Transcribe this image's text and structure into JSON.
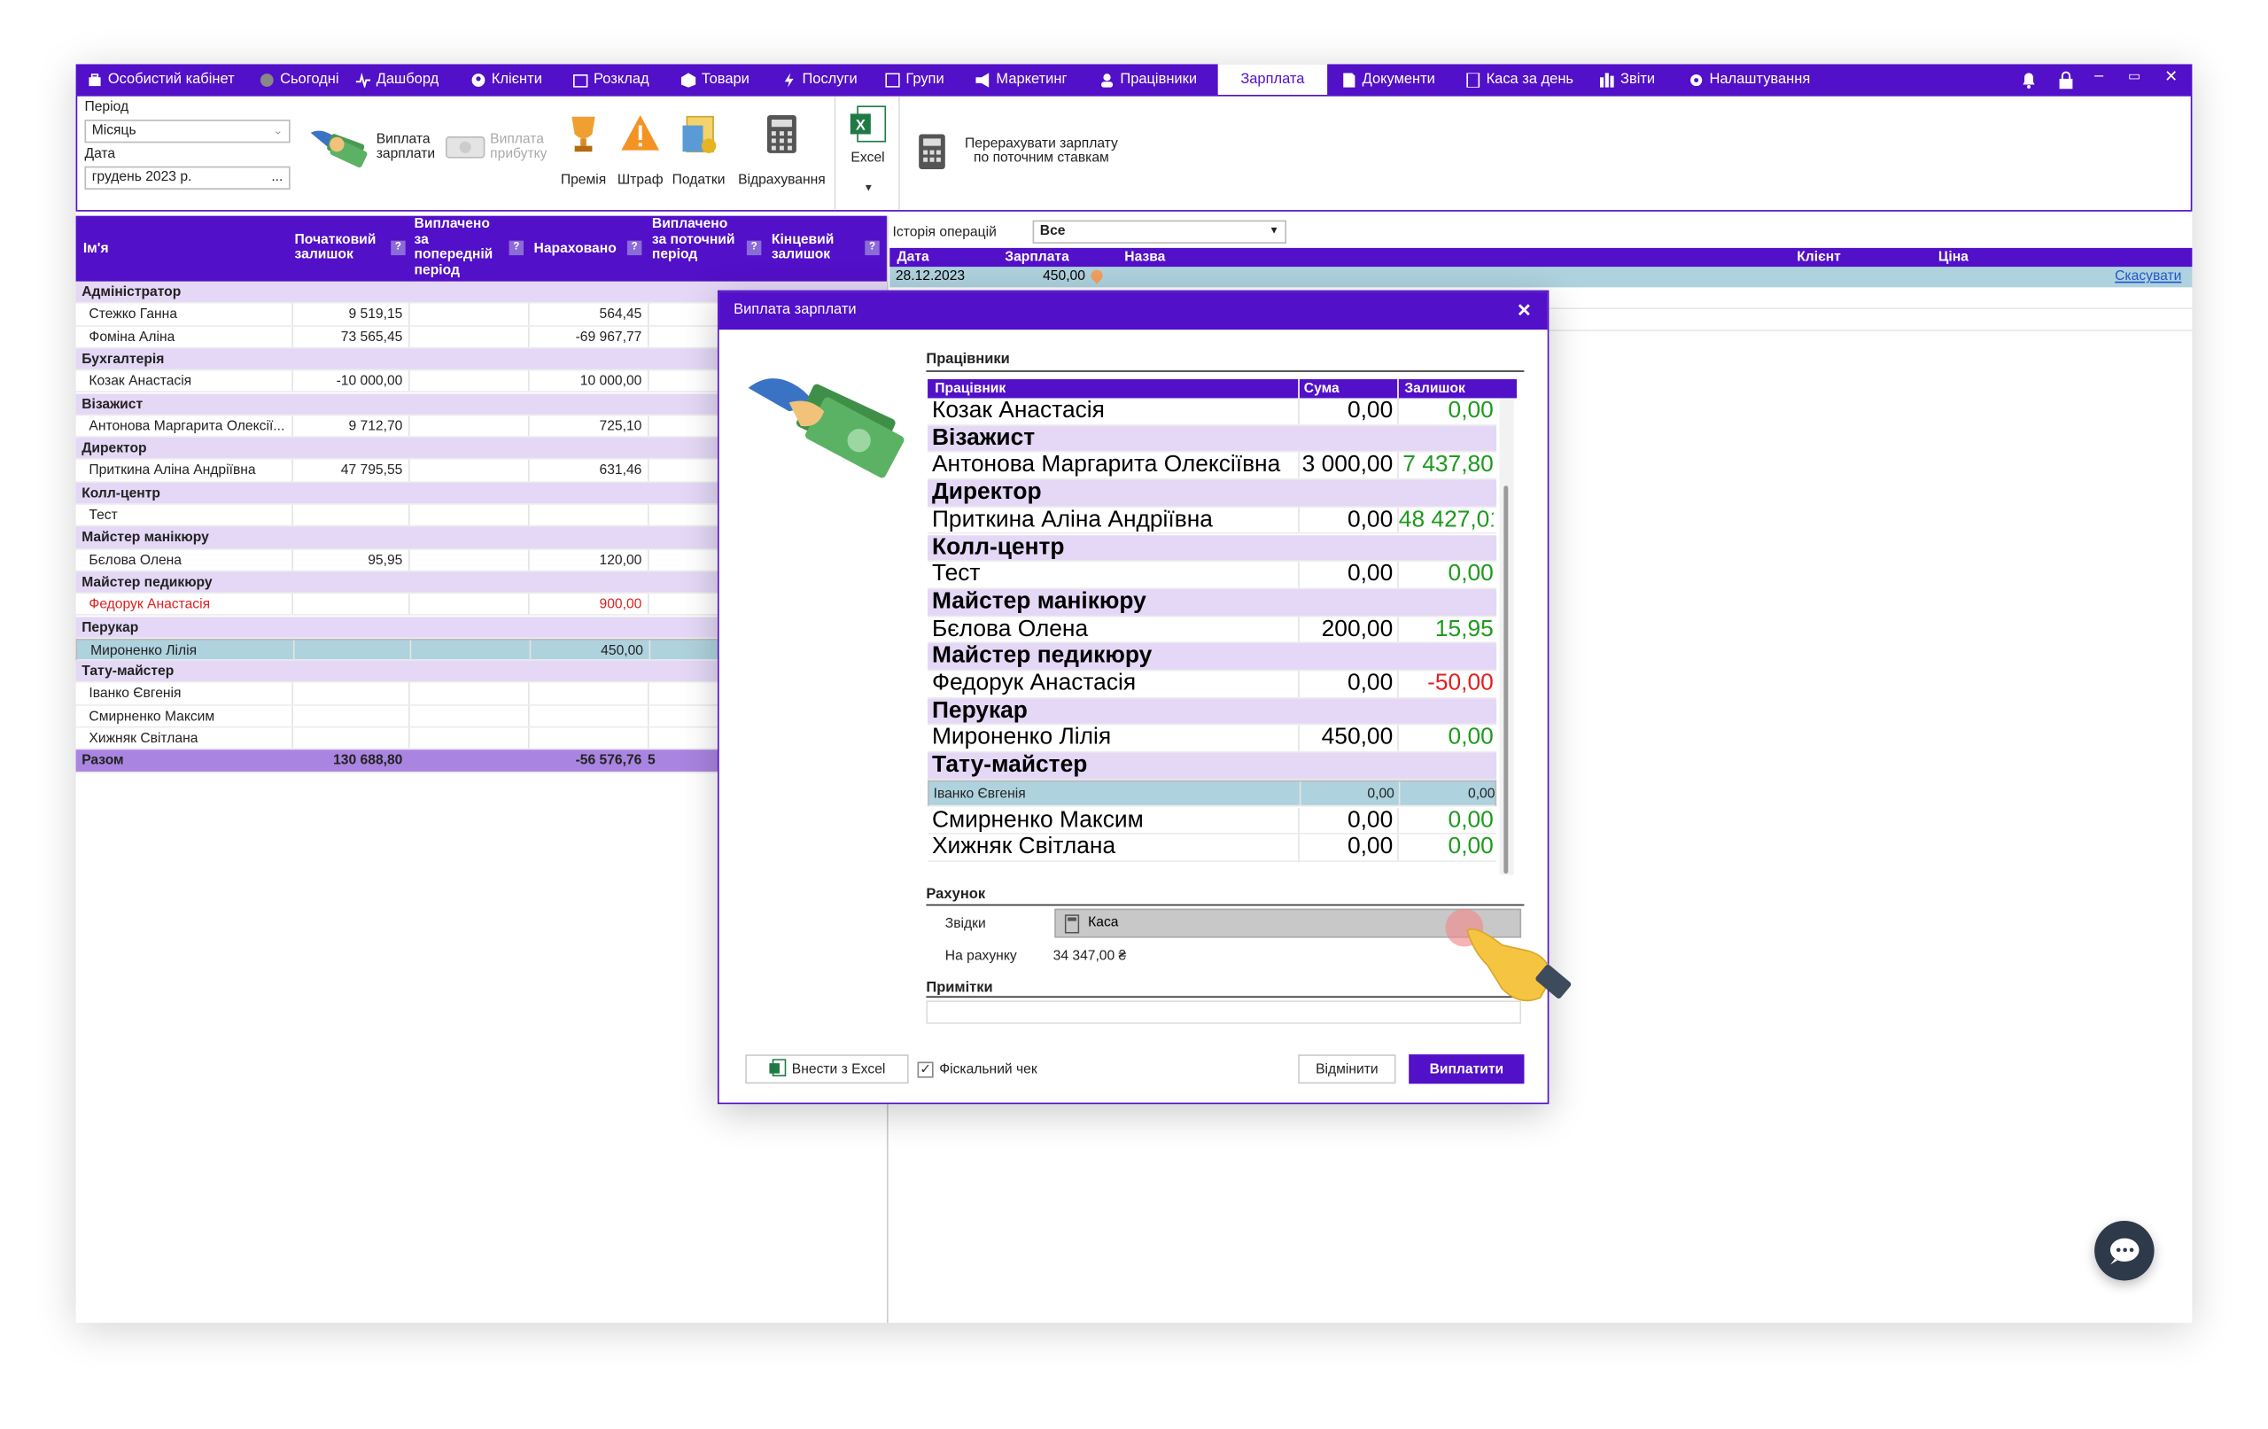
{
  "menu": {
    "items": [
      "Особистий кабінет",
      "Сьогодні",
      "Дашборд",
      "Клієнти",
      "Розклад",
      "Товари",
      "Послуги",
      "Групи",
      "Маркетинг",
      "Працівники",
      "Зарплата",
      "Документи",
      "Каса за день",
      "Звіти",
      "Налаштування"
    ],
    "active": "Зарплата",
    "window_controls": [
      "–",
      "▭",
      "✕"
    ]
  },
  "toolbar": {
    "period_label": "Період",
    "period_value": "Місяць",
    "date_label": "Дата",
    "date_value": "грудень  2023 р.",
    "date_btn": "...",
    "pay_salary": "Виплата зарплати",
    "pay_profit": "Виплата прибутку",
    "bonus": "Премія",
    "fine": "Штраф",
    "taxes": "Податки",
    "deductions": "Відрахування",
    "excel": "Excel",
    "recalc": "Перерахувати зарплату по поточним ставкам"
  },
  "left_table": {
    "headers": [
      "Ім'я",
      "Початковий залишок",
      "Виплачено за попередній період",
      "Нараховано",
      "Виплачено за поточний період",
      "Кінцевий залишок"
    ],
    "help_mark": "?",
    "rows": [
      {
        "type": "group",
        "name": "Адміністратор"
      },
      {
        "type": "row",
        "name": "Стежко Ганна",
        "start": "9 519,15",
        "prev": "",
        "accrued": "564,45"
      },
      {
        "type": "row",
        "name": "Фоміна Аліна",
        "start": "73 565,45",
        "prev": "",
        "accrued": "-69 967,77"
      },
      {
        "type": "group",
        "name": "Бухгалтерія"
      },
      {
        "type": "row",
        "name": "Козак Анастасія",
        "start": "-10 000,00",
        "prev": "",
        "accrued": "10 000,00"
      },
      {
        "type": "group",
        "name": "Візажист"
      },
      {
        "type": "row",
        "name": "Антонова Маргарита Олексії...",
        "start": "9 712,70",
        "prev": "",
        "accrued": "725,10"
      },
      {
        "type": "group",
        "name": "Директор"
      },
      {
        "type": "row",
        "name": "Приткина Аліна Андріївна",
        "start": "47 795,55",
        "prev": "",
        "accrued": "631,46"
      },
      {
        "type": "group",
        "name": "Колл-центр"
      },
      {
        "type": "row",
        "name": "Тест",
        "start": "",
        "prev": "",
        "accrued": ""
      },
      {
        "type": "group",
        "name": "Майстер манікюру"
      },
      {
        "type": "row",
        "name": "Бєлова Олена",
        "start": "95,95",
        "prev": "",
        "accrued": "120,00"
      },
      {
        "type": "group",
        "name": "Майстер педикюру"
      },
      {
        "type": "row-red",
        "name": "Федорук Анастасія",
        "start": "",
        "prev": "",
        "accrued": "900,00"
      },
      {
        "type": "group",
        "name": "Перукар"
      },
      {
        "type": "row-sel",
        "name": "Мироненко Лілія",
        "start": "",
        "prev": "",
        "accrued": "450,00"
      },
      {
        "type": "group",
        "name": "Тату-майстер"
      },
      {
        "type": "row",
        "name": "Іванко Євгенія",
        "start": "",
        "prev": "",
        "accrued": ""
      },
      {
        "type": "row",
        "name": "Смирненко Максим",
        "start": "",
        "prev": "",
        "accrued": ""
      },
      {
        "type": "row",
        "name": "Хижняк Світлана",
        "start": "",
        "prev": "",
        "accrued": ""
      }
    ],
    "total": {
      "name": "Разом",
      "start": "130 688,80",
      "prev": "",
      "accrued": "-56 576,76",
      "paid_cur": "5"
    }
  },
  "history": {
    "label": "Історія операцій",
    "filter": "Все",
    "headers": [
      "Дата",
      "Зарплата",
      "Назва",
      "Клієнт",
      "Ціна"
    ],
    "row": {
      "date": "28.12.2023",
      "salary": "450,00",
      "cancel": "Скасувати"
    }
  },
  "dialog": {
    "title": "Виплата зарплати",
    "close": "✕",
    "employees_section": "Працівники",
    "headers": [
      "Працівник",
      "Сума",
      "Залишок"
    ],
    "rows": [
      {
        "type": "row",
        "name": "Козак Анастасія",
        "sum": "0,00",
        "rest": "0,00",
        "rest_color": "green"
      },
      {
        "type": "group",
        "name": "Візажист"
      },
      {
        "type": "row",
        "name": "Антонова Маргарита Олексіївна",
        "sum": "3 000,00",
        "rest": "7 437,80",
        "rest_color": "green"
      },
      {
        "type": "group",
        "name": "Директор"
      },
      {
        "type": "row",
        "name": "Приткина Аліна Андріївна",
        "sum": "0,00",
        "rest": "48 427,01",
        "rest_color": "green"
      },
      {
        "type": "group",
        "name": "Колл-центр"
      },
      {
        "type": "row",
        "name": "Тест",
        "sum": "0,00",
        "rest": "0,00",
        "rest_color": "green"
      },
      {
        "type": "group",
        "name": "Майстер манікюру"
      },
      {
        "type": "row",
        "name": "Бєлова Олена",
        "sum": "200,00",
        "rest": "15,95",
        "rest_color": "green"
      },
      {
        "type": "group",
        "name": "Майстер педикюру"
      },
      {
        "type": "row",
        "name": "Федорук Анастасія",
        "sum": "0,00",
        "rest": "-50,00",
        "rest_color": "red"
      },
      {
        "type": "group",
        "name": "Перукар"
      },
      {
        "type": "row",
        "name": "Мироненко Лілія",
        "sum": "450,00",
        "rest": "0,00",
        "rest_color": "green"
      },
      {
        "type": "group",
        "name": "Тату-майстер"
      },
      {
        "type": "row-sel",
        "name": "Іванко Євгенія",
        "sum": "0,00",
        "rest": "0,00",
        "rest_color": "dark"
      },
      {
        "type": "row",
        "name": "Смирненко Максим",
        "sum": "0,00",
        "rest": "0,00",
        "rest_color": "green"
      },
      {
        "type": "row",
        "name": "Хижняк Світлана",
        "sum": "0,00",
        "rest": "0,00",
        "rest_color": "green"
      }
    ],
    "account_section": "Рахунок",
    "from_label": "Звідки",
    "from_value": "Каса",
    "balance_label": "На рахунку",
    "balance_value": "34 347,00 ₴",
    "notes_section": "Примітки",
    "import_excel": "Внести з Excel",
    "fiscal_check": "Фіскальний чек",
    "cancel": "Відмінити",
    "pay": "Виплатити"
  },
  "colors": {
    "accent": "#5210c8",
    "group_bg": "#e4d8f6",
    "selected_bg": "#aed2de",
    "total_bg": "#a984e0",
    "green": "#1d9a1d",
    "red": "#e02020"
  }
}
